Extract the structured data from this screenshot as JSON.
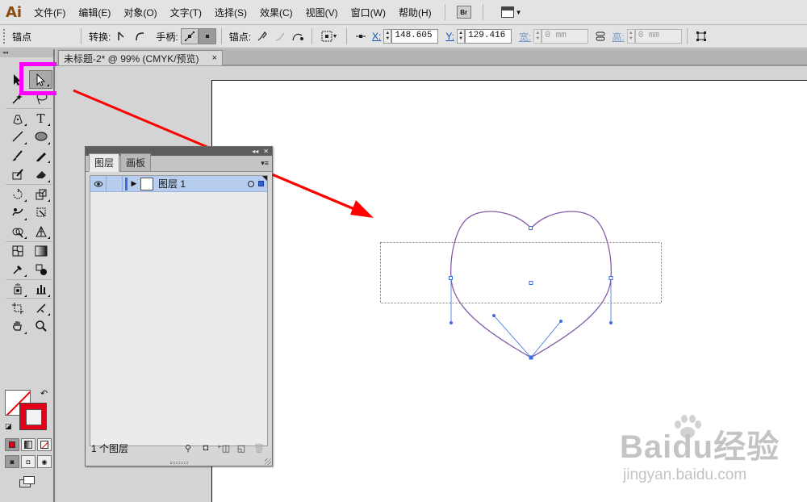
{
  "app": {
    "logo": "Ai"
  },
  "menubar": {
    "items": [
      "文件(F)",
      "编辑(E)",
      "对象(O)",
      "文字(T)",
      "选择(S)",
      "效果(C)",
      "视图(V)",
      "窗口(W)",
      "帮助(H)"
    ],
    "bridge_label": "Br"
  },
  "controlbar": {
    "selection_type": "锚点",
    "convert_label": "转换:",
    "handles_label": "手柄:",
    "anchors_label": "锚点:",
    "x_label": "X:",
    "x_value": "148.605",
    "y_label": "Y:",
    "y_value": "129.416",
    "w_label": "宽:",
    "w_value": "0 mm",
    "h_label": "高:",
    "h_value": "0 mm"
  },
  "document": {
    "tab_title": "未标题-2* @ 99% (CMYK/预览)",
    "close": "×"
  },
  "layers_panel": {
    "tabs": [
      "图层",
      "画板"
    ],
    "active_tab": 0,
    "layers": [
      {
        "name": "图层 1",
        "visible": true,
        "selected": true
      }
    ],
    "footer_count": "1 个图层"
  },
  "watermark": {
    "logo": "Baidu经验",
    "url": "jingyan.baidu.com"
  },
  "colors": {
    "highlight": "#ff00ff",
    "arrow": "#ff0000",
    "stroke": "#e5001a",
    "path": "#7b5fb0",
    "anchor": "#3a6fe0"
  },
  "icons": [
    "direct-selection-icon",
    "group-selection-icon",
    "eye-icon",
    "pen-icon",
    "type-icon",
    "hand-icon",
    "zoom-icon"
  ]
}
